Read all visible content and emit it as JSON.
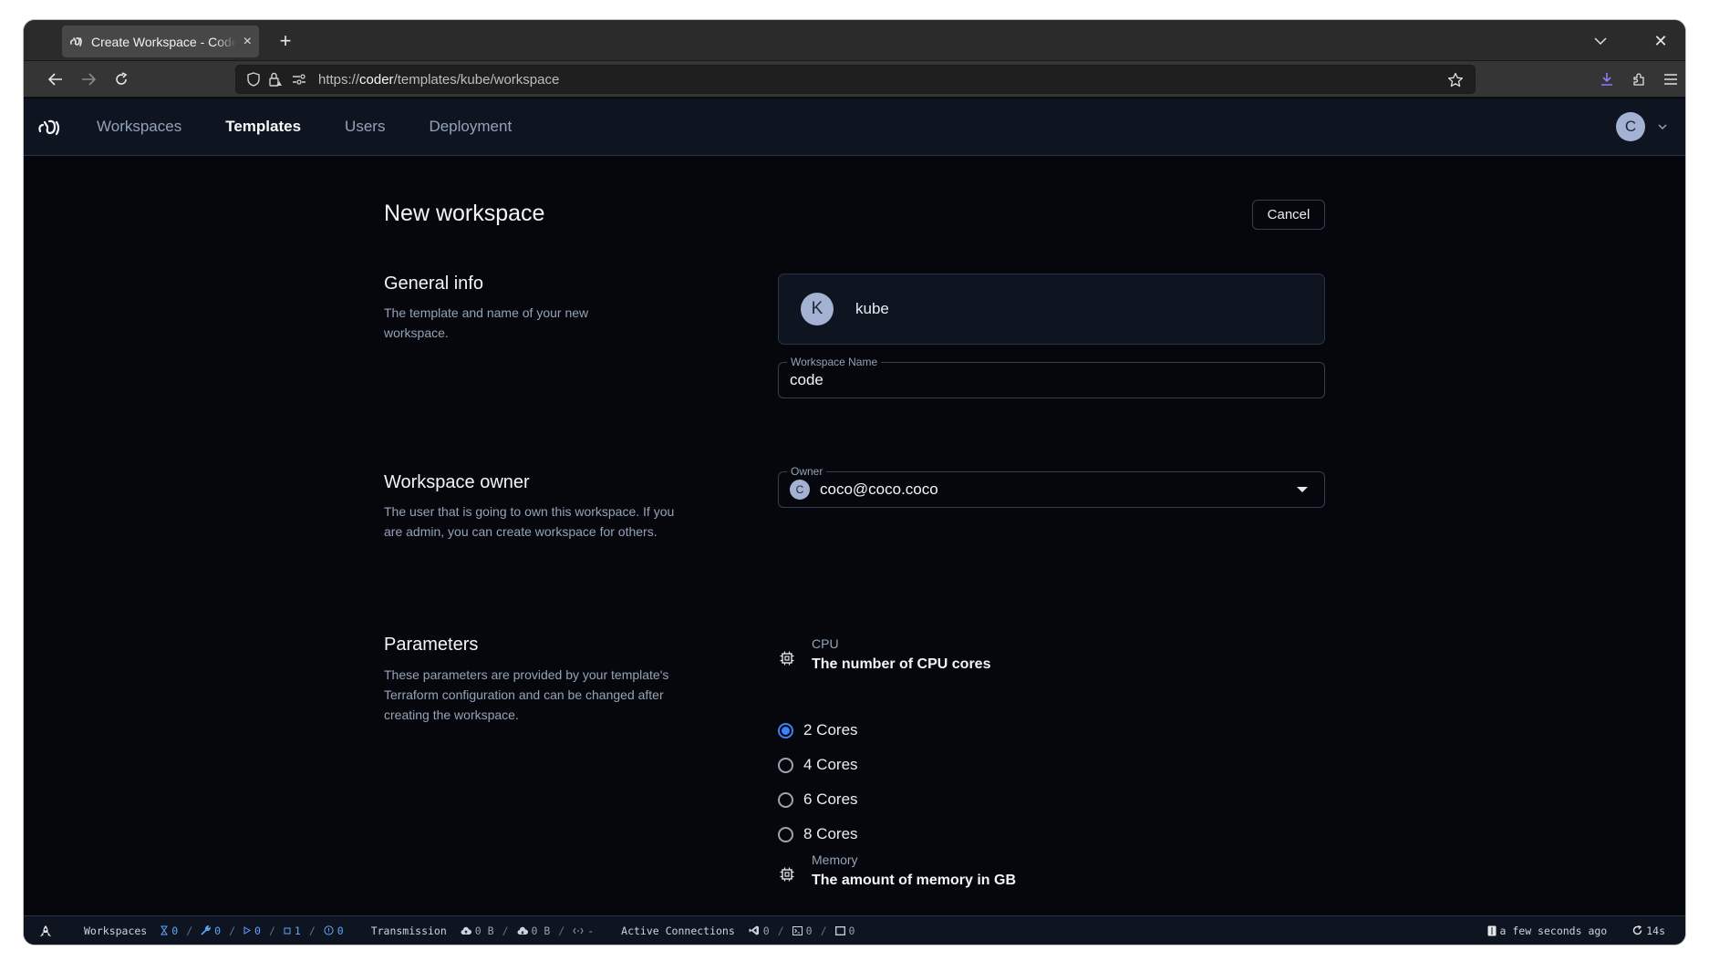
{
  "browser": {
    "tab_title": "Create Workspace - Coder",
    "url_prefix": "https://",
    "url_host": "coder",
    "url_path": "/templates/kube/workspace",
    "new_tab_label": "+",
    "close_tab_glyph": "×",
    "close_window_glyph": "✕"
  },
  "app": {
    "nav": [
      {
        "label": "Workspaces",
        "active": false
      },
      {
        "label": "Templates",
        "active": true
      },
      {
        "label": "Users",
        "active": false
      },
      {
        "label": "Deployment",
        "active": false
      }
    ],
    "user_initial": "C"
  },
  "page": {
    "title": "New workspace",
    "cancel_label": "Cancel",
    "general": {
      "title": "General info",
      "description": "The template and name of your new workspace.",
      "template_initial": "K",
      "template_name": "kube",
      "workspace_name_label": "Workspace Name",
      "workspace_name_value": "code"
    },
    "owner": {
      "title": "Workspace owner",
      "description": "The user that is going to own this workspace. If you are admin, you can create workspace for others.",
      "label": "Owner",
      "avatar_initial": "C",
      "value": "coco@coco.coco"
    },
    "parameters": {
      "title": "Parameters",
      "description": "These parameters are provided by your template's Terraform configuration and can be changed after creating the workspace.",
      "cpu": {
        "name": "CPU",
        "description": "The number of CPU cores",
        "icon": "chip-icon",
        "options": [
          {
            "label": "2 Cores",
            "checked": true
          },
          {
            "label": "4 Cores",
            "checked": false
          },
          {
            "label": "6 Cores",
            "checked": false
          },
          {
            "label": "8 Cores",
            "checked": false
          }
        ]
      },
      "memory": {
        "name": "Memory",
        "description": "The amount of memory in GB",
        "icon": "chip-icon"
      }
    }
  },
  "statusbar": {
    "workspaces_label": "Workspaces",
    "pending": "0",
    "building": "0",
    "running": "0",
    "stopped": "1",
    "failed": "0",
    "transmission_label": "Transmission",
    "upload": "0 B",
    "download": "0 B",
    "latency": "-",
    "connections_label": "Active Connections",
    "vscode": "0",
    "terminal": "0",
    "app": "0",
    "updated": "a few seconds ago",
    "refresh": "14s"
  },
  "colors": {
    "accent": "#3b82f6",
    "status_blue": "#60a5fa",
    "download_icon": "#8b7cf6",
    "avatar": "#a3b2d3"
  }
}
